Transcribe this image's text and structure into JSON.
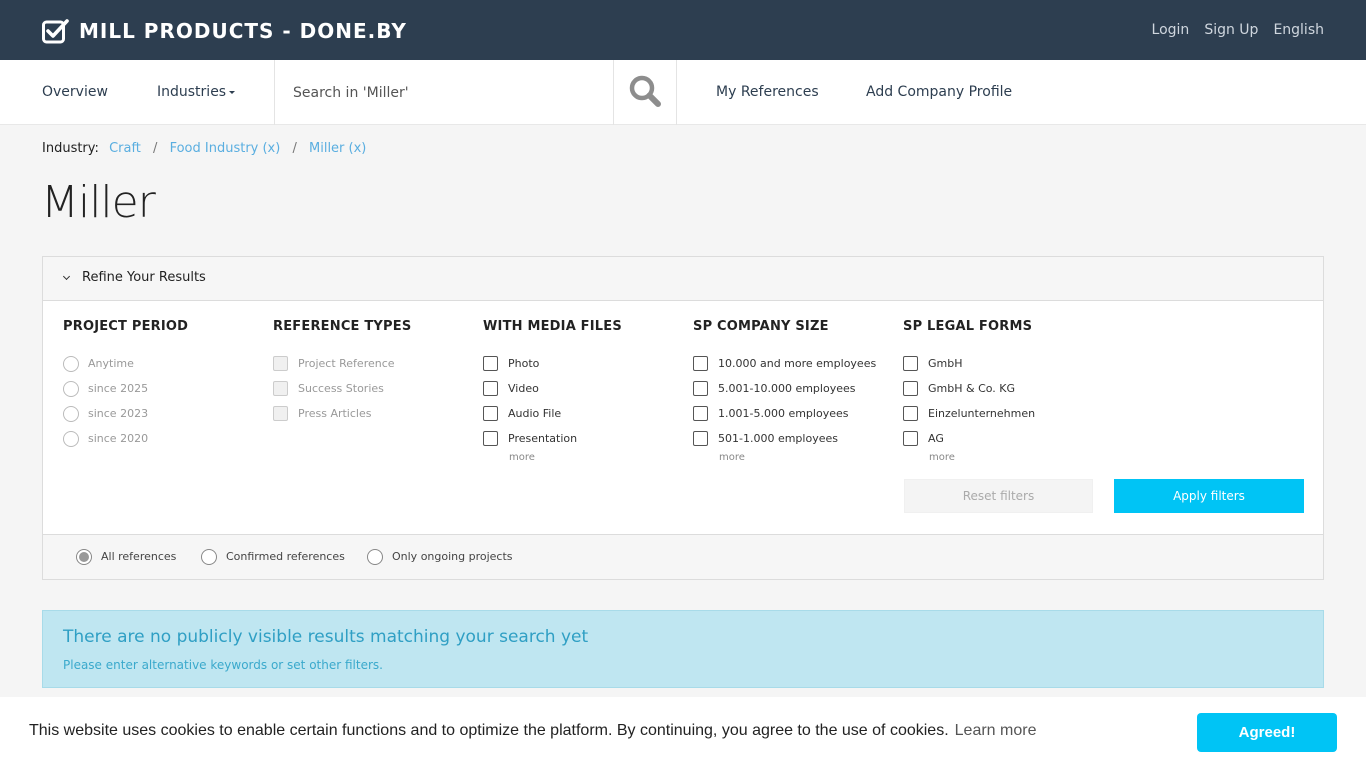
{
  "header": {
    "brand": "MILL PRODUCTS - DONE.BY",
    "links": [
      "Login",
      "Sign Up",
      "English"
    ]
  },
  "nav": {
    "overview": "Overview",
    "industries": "Industries",
    "search_placeholder": "Search in 'Miller'",
    "my_references": "My References",
    "add_company_profile": "Add Company Profile"
  },
  "breadcrumb": {
    "label": "Industry:",
    "items": [
      "Craft",
      "Food Industry (x)",
      "Miller (x)"
    ],
    "separator": "/"
  },
  "page_title": "Miller",
  "filters": {
    "title": "Refine Your Results",
    "project_period": {
      "heading": "PROJECT PERIOD",
      "options": [
        "Anytime",
        "since 2025",
        "since 2023",
        "since 2020"
      ]
    },
    "reference_types": {
      "heading": "REFERENCE TYPES",
      "options": [
        "Project Reference",
        "Success Stories",
        "Press Articles"
      ]
    },
    "media_files": {
      "heading": "WITH MEDIA FILES",
      "options": [
        "Photo",
        "Video",
        "Audio File",
        "Presentation"
      ],
      "more": "more"
    },
    "company_size": {
      "heading": "SP COMPANY SIZE",
      "options": [
        "10.000 and more employees",
        "5.001-10.000 employees",
        "1.001-5.000 employees",
        "501-1.000 employees"
      ],
      "more": "more"
    },
    "legal_forms": {
      "heading": "SP LEGAL FORMS",
      "options": [
        "GmbH",
        "GmbH & Co. KG",
        "Einzelunternehmen",
        "AG"
      ],
      "more": "more"
    },
    "reset_label": "Reset filters",
    "apply_label": "Apply filters",
    "scope": {
      "options": [
        "All references",
        "Confirmed references",
        "Only ongoing projects"
      ],
      "selected": "All references"
    }
  },
  "alert": {
    "title": "There are no publicly visible results matching your search yet",
    "text": "Please enter alternative keywords or set other filters."
  },
  "cookie": {
    "text": "This website uses cookies to enable certain functions and to optimize the platform. By continuing, you agree to the use of cookies.",
    "learn_more": "Learn more",
    "agree": "Agreed!"
  },
  "colors": {
    "header_bg": "#2d3e50",
    "accent": "#00c4f5",
    "link": "#5aaee0",
    "alert_bg": "#bfe6f1"
  },
  "icons": [
    "check-square-icon",
    "search-icon",
    "chevron-down-icon",
    "caret-down-icon"
  ]
}
